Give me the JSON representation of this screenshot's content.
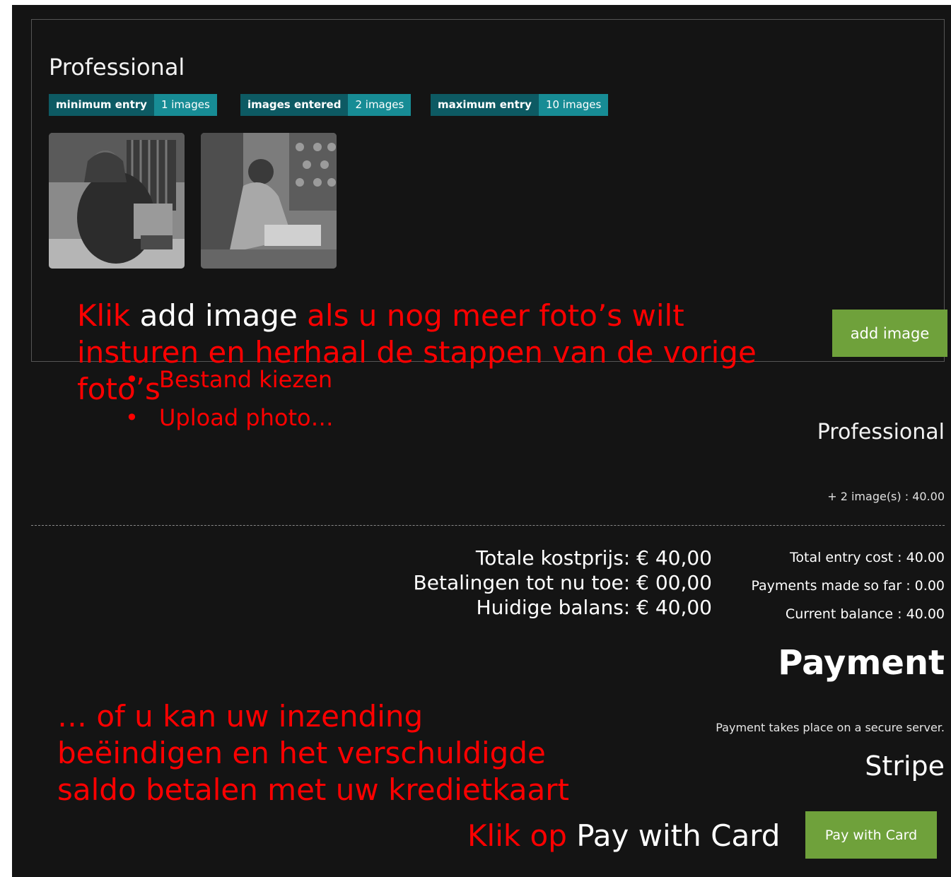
{
  "category": {
    "title": "Professional",
    "badges": [
      {
        "label": "minimum entry",
        "value": "1 images"
      },
      {
        "label": "images entered",
        "value": "2 images"
      },
      {
        "label": "maximum entry",
        "value": "10 images"
      }
    ],
    "add_image_label": "add image"
  },
  "annotation_add": {
    "part1": "Klik",
    "part2": "add image",
    "part3": "als u nog meer foto’s wilt insturen en herhaal de stappen van de vorige foto’s",
    "bullets": [
      "Bestand kiezen",
      "Upload photo…"
    ],
    "bullet_symbol": "•"
  },
  "summary": {
    "title": "Professional",
    "line": "+ 2 image(s) : 40.00"
  },
  "totals_nl": {
    "line1": "Totale kostprijs: € 40,00",
    "line2": "Betalingen tot nu toe: € 00,00",
    "line3": "Huidige balans: € 40,00"
  },
  "totals_en": {
    "line1": "Total entry cost : 40.00",
    "line2": "Payments made so far : 0.00",
    "line3": "Current balance : 40.00"
  },
  "payment": {
    "heading": "Payment",
    "note": "Payment takes place on a secure server.",
    "provider": "Stripe",
    "button_label": "Pay with Card"
  },
  "annotation_pay": {
    "text": "… of u kan uw inzending beëindigen en het verschuldigde saldo betalen met uw kredietkaart",
    "click_part1": "Klik op",
    "click_part2": "Pay with Card"
  },
  "colors": {
    "background": "#141414",
    "annotation_red": "#ff0000",
    "button_green": "#6fa13b",
    "badge_dark": "#0d5a63",
    "badge_light": "#178c95"
  }
}
